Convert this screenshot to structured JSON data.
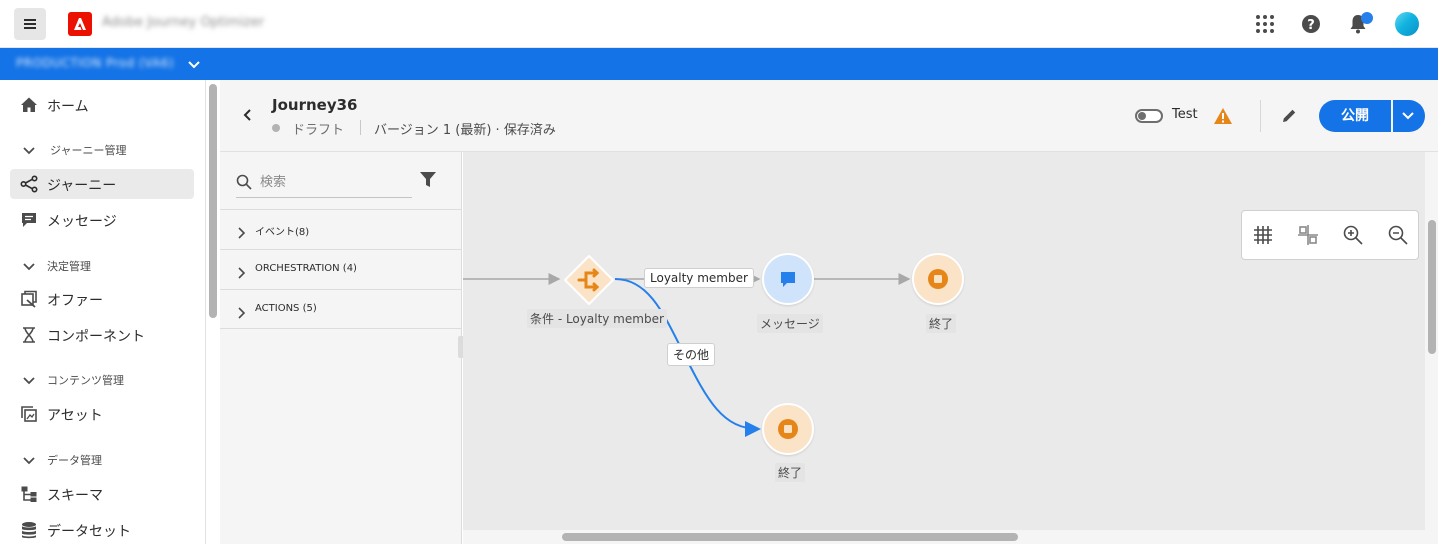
{
  "top_bar": {
    "app_title": "Adobe Journey Optimizer",
    "icons": [
      "menu-icon",
      "adobe-logo",
      "apps-grid-icon",
      "help-icon",
      "bell-icon",
      "avatar"
    ]
  },
  "sandbox_bar": {
    "label": "PRODUCTION Prod (VA6)"
  },
  "left_nav": {
    "home": "ホーム",
    "section_journey_mgmt": "ジャーニー管理",
    "journeys": "ジャーニー",
    "messages": "メッセージ",
    "section_decision_mgmt": "決定管理",
    "offers": "オファー",
    "components": "コンポーネント",
    "section_content_mgmt": "コンテンツ管理",
    "assets": "アセット",
    "section_data_mgmt": "データ管理",
    "schemas": "スキーマ",
    "datasets": "データセット"
  },
  "journey_header": {
    "title": "Journey36",
    "status": "ドラフト",
    "version": "バージョン 1 (最新) · 保存済み",
    "test_label": "Test",
    "publish_label": "公開"
  },
  "palette": {
    "search_placeholder": "検索",
    "sections": [
      {
        "label": "イベント(8)"
      },
      {
        "label": "ORCHESTRATION (4)"
      },
      {
        "label": "ACTIONS (5)"
      }
    ]
  },
  "canvas": {
    "condition_node_label": "条件 - Loyalty member",
    "edge_loyalty_label": "Loyalty member",
    "edge_other_label": "その他",
    "message_node_label": "メッセージ",
    "end_node_label_1": "終了",
    "end_node_label_2": "終了"
  },
  "colors": {
    "accent_blue": "#1473e6",
    "condition_orange": "#e68619",
    "end_orange": "#e68619",
    "message_blue": "#2680eb",
    "warning": "#e68619"
  }
}
